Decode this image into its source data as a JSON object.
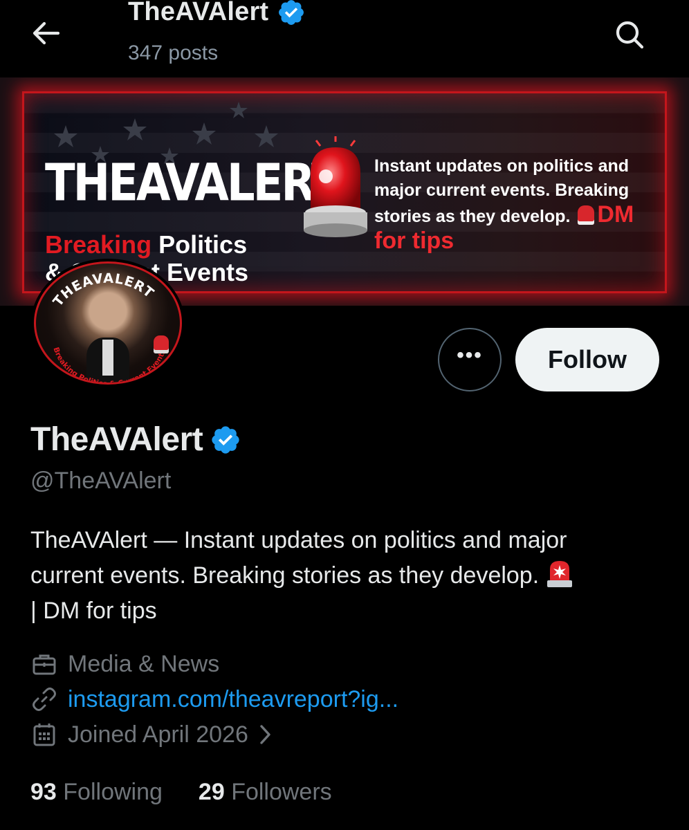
{
  "header": {
    "title": "TheAVAlert",
    "posts": "347 posts"
  },
  "banner": {
    "brand": "THEAVALERT",
    "sub_red": "Breaking",
    "sub_line1_rest": " Politics",
    "sub_line2": "& Current Events",
    "tagline": "Instant updates on politics and major current events. Breaking stories as they develop.",
    "dm": "DM for tips"
  },
  "avatar": {
    "ring_top": "THEAVALERT",
    "ring_bottom": "Breaking Politics & Current Events"
  },
  "actions": {
    "more_label": "•••",
    "follow_label": "Follow"
  },
  "profile": {
    "name": "TheAVAlert",
    "handle": "@TheAVAlert",
    "bio_line1": "TheAVAlert — Instant updates on politics and major",
    "bio_line2": "current events. Breaking stories as they develop.",
    "bio_line3": "| DM for tips",
    "category": "Media & News",
    "link": "instagram.com/theavreport?ig...",
    "joined": "Joined April 2026"
  },
  "stats": {
    "following_count": "93",
    "following_label": "Following",
    "followers_count": "29",
    "followers_label": "Followers"
  },
  "colors": {
    "accent": "#1d9bf0",
    "banner_red": "#e11b22",
    "background": "#000000"
  },
  "icons": [
    "back-arrow-icon",
    "search-icon",
    "verified-badge-icon",
    "briefcase-icon",
    "link-icon",
    "calendar-icon",
    "chevron-right-icon",
    "siren-emoji-icon"
  ]
}
